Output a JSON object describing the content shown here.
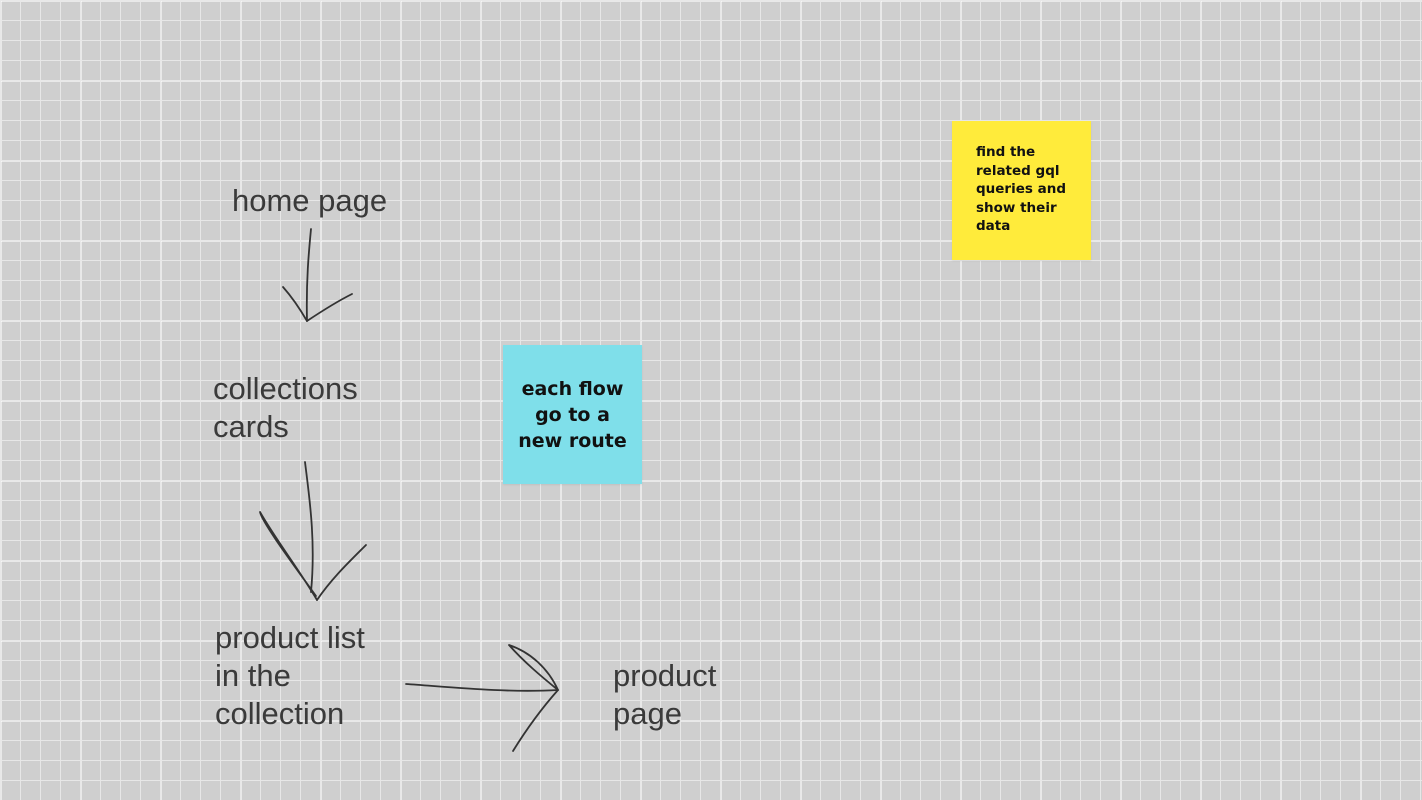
{
  "board": {
    "text_color": "#3a3a3a",
    "texts": {
      "home_page": "home page",
      "collections_cards": "collections\ncards",
      "product_list": "product list\nin the\ncollection",
      "product_page": "product\npage"
    },
    "stickies": {
      "cyan": {
        "text": "each flow\ngo to a\nnew route",
        "color": "#7fdfea"
      },
      "yellow": {
        "text": "find the\nrelated gql\nqueries and\nshow their\ndata",
        "color": "#ffeb3b"
      }
    },
    "ink_color": "#333333"
  }
}
